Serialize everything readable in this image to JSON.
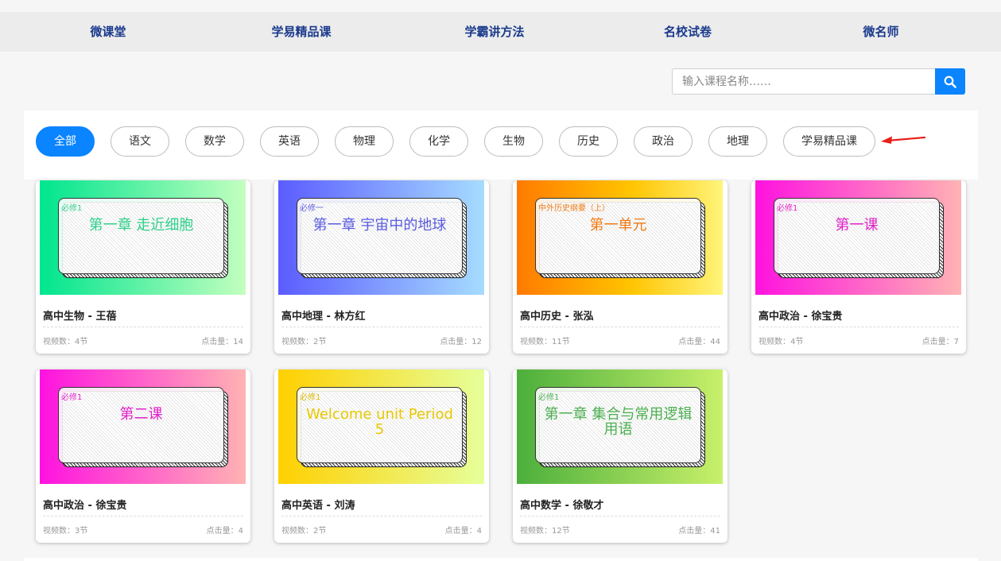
{
  "nav": [
    {
      "label": "微课堂"
    },
    {
      "label": "学易精品课"
    },
    {
      "label": "学霸讲方法"
    },
    {
      "label": "名校试卷"
    },
    {
      "label": "微名师"
    }
  ],
  "search": {
    "placeholder": "输入课程名称……",
    "value": ""
  },
  "filters": [
    {
      "label": "全部",
      "active": true
    },
    {
      "label": "语文"
    },
    {
      "label": "数学"
    },
    {
      "label": "英语"
    },
    {
      "label": "物理"
    },
    {
      "label": "化学"
    },
    {
      "label": "生物"
    },
    {
      "label": "历史"
    },
    {
      "label": "政治"
    },
    {
      "label": "地理"
    },
    {
      "label": "学易精品课"
    }
  ],
  "colors": {
    "accent": "#0a84ff",
    "nav_text": "#1a3a8c",
    "arrow": "#e8201a"
  },
  "courses": [
    {
      "tag": "必修1",
      "heading": "第一章 走近细胞",
      "title": "高中生物 - 王蓓",
      "videos": "视频数：4节",
      "clicks": "点击量：14",
      "gradient": [
        "#00e58e",
        "#c3ffbf"
      ],
      "text_color": "#2fd08a"
    },
    {
      "tag": "必修一",
      "heading": "第一章 宇宙中的地球",
      "title": "高中地理 - 林方红",
      "videos": "视频数：2节",
      "clicks": "点击量：12",
      "gradient": [
        "#5b5cff",
        "#a6dcff"
      ],
      "text_color": "#5a5ce0"
    },
    {
      "tag": "中外历史纲要（上）",
      "heading": "第一单元",
      "title": "高中历史 - 张泓",
      "videos": "视频数：11节",
      "clicks": "点击量：44",
      "gradient": [
        "#ff7a00",
        "#fff47a"
      ],
      "text_color": "#f07a14"
    },
    {
      "tag": "必修1",
      "heading": "第一课",
      "title": "高中政治 - 徐宝贵",
      "videos": "视频数：4节",
      "clicks": "点击量：7",
      "gradient": [
        "#ff12e0",
        "#ffb3b3"
      ],
      "text_color": "#e020c8"
    },
    {
      "tag": "必修1",
      "heading": "第二课",
      "title": "高中政治 - 徐宝贵",
      "videos": "视频数：3节",
      "clicks": "点击量：4",
      "gradient": [
        "#ff12e0",
        "#ffb3b3"
      ],
      "text_color": "#e020c8"
    },
    {
      "tag": "必修1",
      "heading": "Welcome unit Period 5",
      "title": "高中英语 - 刘涛",
      "videos": "视频数：2节",
      "clicks": "点击量：4",
      "gradient": [
        "#ffd000",
        "#e6ff9a"
      ],
      "text_color": "#e8c800"
    },
    {
      "tag": "必修1",
      "heading": "第一章 集合与常用逻辑用语",
      "title": "高中数学 - 徐敬才",
      "videos": "视频数：12节",
      "clicks": "点击量：41",
      "gradient": [
        "#4caf3c",
        "#c8f06a"
      ],
      "text_color": "#4caf50"
    }
  ]
}
